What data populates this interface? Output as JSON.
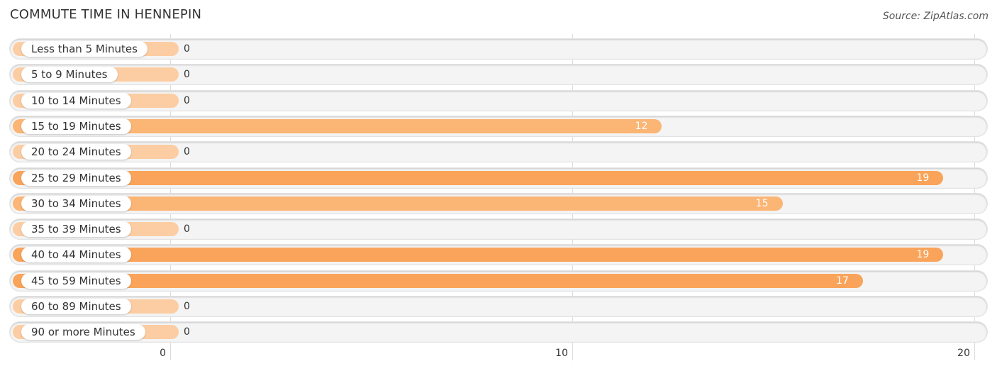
{
  "header": {
    "title": "COMMUTE TIME IN HENNEPIN",
    "source": "Source: ZipAtlas.com"
  },
  "colors": {
    "bar_strong": "#f9a45a",
    "bar_medium": "#fbb574",
    "bar_zero": "#fccda3",
    "track": "#f4f4f4"
  },
  "chart_data": {
    "type": "bar",
    "orientation": "horizontal",
    "title": "COMMUTE TIME IN HENNEPIN",
    "xlabel": "",
    "ylabel": "",
    "xlim": [
      0,
      20
    ],
    "xticks": [
      "0",
      "10",
      "20"
    ],
    "grid": true,
    "categories": [
      "Less than 5 Minutes",
      "5 to 9 Minutes",
      "10 to 14 Minutes",
      "15 to 19 Minutes",
      "20 to 24 Minutes",
      "25 to 29 Minutes",
      "30 to 34 Minutes",
      "35 to 39 Minutes",
      "40 to 44 Minutes",
      "45 to 59 Minutes",
      "60 to 89 Minutes",
      "90 or more Minutes"
    ],
    "values": [
      0,
      0,
      0,
      12,
      0,
      19,
      15,
      0,
      19,
      17,
      0,
      0
    ],
    "value_labels": [
      "0",
      "0",
      "0",
      "12",
      "0",
      "19",
      "15",
      "0",
      "19",
      "17",
      "0",
      "0"
    ]
  }
}
